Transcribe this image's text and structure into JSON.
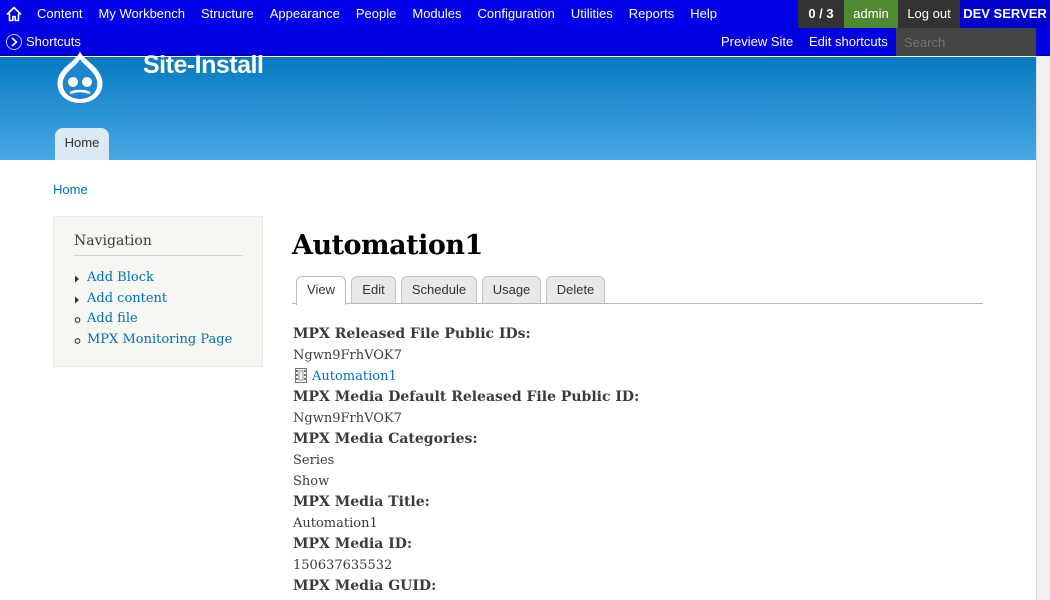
{
  "toolbar": {
    "menu": [
      "Content",
      "My Workbench",
      "Structure",
      "Appearance",
      "People",
      "Modules",
      "Configuration",
      "Utilities",
      "Reports",
      "Help"
    ],
    "count": "0 / 3",
    "user": "admin",
    "logout": "Log out",
    "env": "DEV SERVER"
  },
  "shortcuts": {
    "label": "Shortcuts",
    "preview": "Preview Site",
    "edit": "Edit shortcuts",
    "search_placeholder": "Search"
  },
  "header": {
    "site_name": "Site-Install",
    "home_tab": "Home"
  },
  "breadcrumb": "Home",
  "sidebar": {
    "title": "Navigation",
    "items": [
      {
        "label": "Add Block",
        "type": "collapsed"
      },
      {
        "label": "Add content",
        "type": "collapsed"
      },
      {
        "label": "Add file",
        "type": "leaf"
      },
      {
        "label": "MPX Monitoring Page",
        "type": "leaf"
      }
    ]
  },
  "page": {
    "title": "Automation1",
    "tabs": [
      "View",
      "Edit",
      "Schedule",
      "Usage",
      "Delete"
    ],
    "active_tab": "View"
  },
  "fields": {
    "released_ids_label": "MPX Released File Public IDs:",
    "released_ids_value": "Ngwn9FrhVOK7",
    "file_link": "Automation1",
    "default_id_label": "MPX Media Default Released File Public ID:",
    "default_id_value": "Ngwn9FrhVOK7",
    "categories_label": "MPX Media Categories:",
    "categories": [
      "Series",
      "Show"
    ],
    "media_title_label": "MPX Media Title:",
    "media_title_value": "Automation1",
    "media_id_label": "MPX Media ID:",
    "media_id_value": "150637635532",
    "guid_label": "MPX Media GUID:"
  }
}
